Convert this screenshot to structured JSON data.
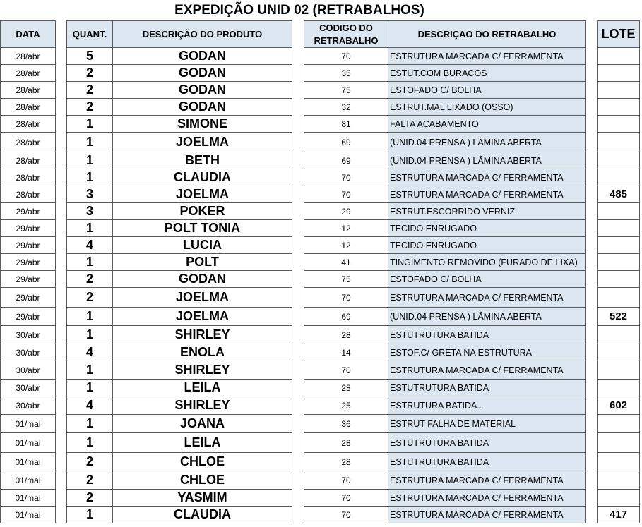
{
  "title": "EXPEDIÇÃO UNID 02 (RETRABALHOS)",
  "headers": {
    "data": "DATA",
    "quant": "QUANT.",
    "produto": "DESCRIÇÃO DO PRODUTO",
    "codigo_line1": "CODIGO DO",
    "codigo_line2": "RETRABALHO",
    "retrabalho": "DESCRIÇAO DO RETRABALHO",
    "lote": "LOTE"
  },
  "rows": [
    {
      "date": "28/abr",
      "qty": "5",
      "product": "GODAN",
      "code": "70",
      "description": "ESTRUTURA MARCADA C/ FERRAMENTA",
      "lote": ""
    },
    {
      "date": "28/abr",
      "qty": "2",
      "product": "GODAN",
      "code": "35",
      "description": "ESTUT.COM BURACOS",
      "lote": ""
    },
    {
      "date": "28/abr",
      "qty": "2",
      "product": "GODAN",
      "code": "75",
      "description": "ESTOFADO C/ BOLHA",
      "lote": ""
    },
    {
      "date": "28/abr",
      "qty": "2",
      "product": "GODAN",
      "code": "32",
      "description": "ESTRUT.MAL LIXADO (OSSO)",
      "lote": ""
    },
    {
      "date": "28/abr",
      "qty": "1",
      "product": "SIMONE",
      "code": "81",
      "description": "FALTA ACABAMENTO",
      "lote": ""
    },
    {
      "date": "28/abr",
      "qty": "1",
      "product": "JOELMA",
      "code": "69",
      "description": "(UNID.04 PRENSA ) LÂMINA ABERTA",
      "lote": ""
    },
    {
      "date": "28/abr",
      "qty": "1",
      "product": "BETH",
      "code": "69",
      "description": "(UNID.04 PRENSA ) LÂMINA ABERTA",
      "lote": ""
    },
    {
      "date": "28/abr",
      "qty": "1",
      "product": "CLAUDIA",
      "code": "70",
      "description": "ESTRUTURA MARCADA C/ FERRAMENTA",
      "lote": ""
    },
    {
      "date": "28/abr",
      "qty": "3",
      "product": "JOELMA",
      "code": "70",
      "description": "ESTRUTURA MARCADA C/ FERRAMENTA",
      "lote": "485"
    },
    {
      "date": "29/abr",
      "qty": "3",
      "product": "POKER",
      "code": "29",
      "description": "ESTRUT.ESCORRIDO VERNIZ",
      "lote": ""
    },
    {
      "date": "29/abr",
      "qty": "1",
      "product": "POLT TONIA",
      "code": "12",
      "description": "TECIDO ENRUGADO",
      "lote": ""
    },
    {
      "date": "29/abr",
      "qty": "4",
      "product": "LUCIA",
      "code": "12",
      "description": "TECIDO ENRUGADO",
      "lote": ""
    },
    {
      "date": "29/abr",
      "qty": "1",
      "product": "POLT",
      "code": "41",
      "description": "TINGIMENTO REMOVIDO (FURADO DE LIXA)",
      "lote": ""
    },
    {
      "date": "29/abr",
      "qty": "2",
      "product": "GODAN",
      "code": "75",
      "description": "ESTOFADO C/ BOLHA",
      "lote": ""
    },
    {
      "date": "29/abr",
      "qty": "2",
      "product": "JOELMA",
      "code": "70",
      "description": "ESTRUTURA MARCADA C/ FERRAMENTA",
      "lote": ""
    },
    {
      "date": "29/abr",
      "qty": "1",
      "product": "JOELMA",
      "code": "69",
      "description": "(UNID.04 PRENSA ) LÂMINA ABERTA",
      "lote": "522"
    },
    {
      "date": "30/abr",
      "qty": "1",
      "product": "SHIRLEY",
      "code": "28",
      "description": "ESTUTRUTURA BATIDA",
      "lote": ""
    },
    {
      "date": "30/abr",
      "qty": "4",
      "product": "ENOLA",
      "code": "14",
      "description": "ESTOF.C/ GRETA NA ESTRUTURA",
      "lote": ""
    },
    {
      "date": "30/abr",
      "qty": "1",
      "product": "SHIRLEY",
      "code": "70",
      "description": "ESTRUTURA MARCADA C/ FERRAMENTA",
      "lote": ""
    },
    {
      "date": "30/abr",
      "qty": "1",
      "product": "LEILA",
      "code": "28",
      "description": "ESTUTRUTURA BATIDA",
      "lote": ""
    },
    {
      "date": "30/abr",
      "qty": "4",
      "product": "SHIRLEY",
      "code": "25",
      "description": "ESTRUTURA BATIDA..",
      "lote": "602"
    },
    {
      "date": "01/mai",
      "qty": "1",
      "product": "JOANA",
      "code": "36",
      "description": "ESTRUT FALHA DE MATERIAL",
      "lote": ""
    },
    {
      "date": "01/mai",
      "qty": "1",
      "product": "LEILA",
      "code": "28",
      "description": "ESTUTRUTURA BATIDA",
      "lote": ""
    },
    {
      "date": "01/mai",
      "qty": "2",
      "product": "CHLOE",
      "code": "28",
      "description": "ESTUTRUTURA BATIDA",
      "lote": ""
    },
    {
      "date": "01/mai",
      "qty": "2",
      "product": "CHLOE",
      "code": "70",
      "description": "ESTRUTURA MARCADA C/ FERRAMENTA",
      "lote": ""
    },
    {
      "date": "01/mai",
      "qty": "2",
      "product": "YASMIM",
      "code": "70",
      "description": "ESTRUTURA MARCADA C/ FERRAMENTA",
      "lote": ""
    },
    {
      "date": "01/mai",
      "qty": "1",
      "product": "CLAUDIA",
      "code": "70",
      "description": "ESTRUTURA MARCADA C/ FERRAMENTA",
      "lote": "417"
    }
  ]
}
